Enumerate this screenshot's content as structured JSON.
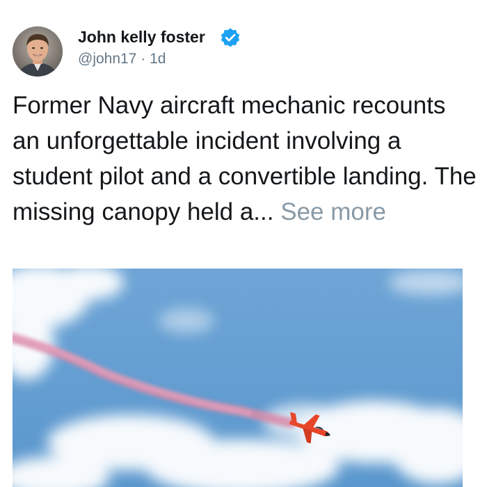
{
  "author": {
    "name": "John kelly foster",
    "handle": "@john17",
    "separator": "·",
    "time": "1d",
    "verified": true,
    "avatar_icon": "profile-photo"
  },
  "post": {
    "text": "Former Navy aircraft mechanic recounts an unforgettable incident involving a student pilot and a convertible landing. The missing canopy held a...",
    "see_more": "See more"
  },
  "media": {
    "icon": "jet-smoke-photo"
  },
  "colors": {
    "verified": "#1da1f2",
    "muted": "#657786",
    "see_more": "#8899a6",
    "sky": "#5f9bd0",
    "smoke": "#d98aa8",
    "jet": "#e8462a"
  }
}
